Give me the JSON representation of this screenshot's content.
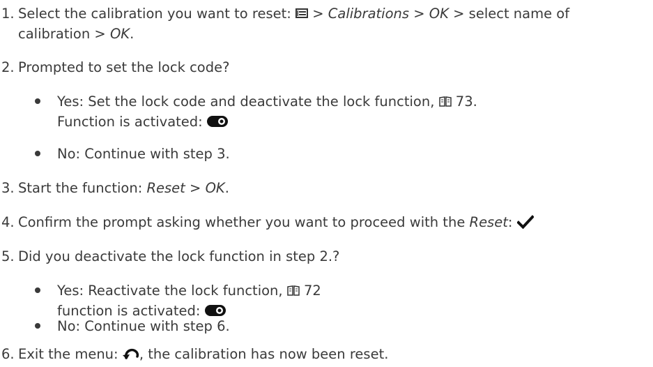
{
  "steps": [
    {
      "number": "1.",
      "text_a": "Select the calibration you want to reset: ",
      "menu_icon": "menu-icon",
      "text_b": " > ",
      "italic_1": "Calibrations",
      "text_c": " > ",
      "italic_2": "OK",
      "text_d": " > select name of",
      "line2_a": "calibration > ",
      "line2_italic": "OK",
      "line2_b": "."
    },
    {
      "number": "2.",
      "text": "Prompted to set the lock code?",
      "bullets": [
        {
          "text_a": "Yes: Set the lock code and deactivate the lock function, ",
          "book_icon": "book-icon",
          "page_ref": " 73.",
          "line2": "Function is activated: ",
          "toggle_icon": "toggle-on-icon"
        },
        {
          "text": "No: Continue with step 3."
        }
      ]
    },
    {
      "number": "3.",
      "text_a": "Start the function: ",
      "italic_1": "Reset",
      "text_b": " > ",
      "italic_2": "OK",
      "text_c": "."
    },
    {
      "number": "4.",
      "text_a": "Confirm the prompt asking whether you want to proceed with the ",
      "italic_1": "Reset",
      "text_b": ": ",
      "check_icon": "checkmark-icon"
    },
    {
      "number": "5.",
      "text": "Did you deactivate the lock function in step 2.?",
      "bullets": [
        {
          "text_a": "Yes: Reactivate the lock function, ",
          "book_icon": "book-icon",
          "page_ref": " 72",
          "line2": "function is activated: ",
          "toggle_icon": "toggle-on-icon"
        },
        {
          "text": "No: Continue with step 6."
        }
      ]
    },
    {
      "number": "6.",
      "text_a": "Exit the menu: ",
      "back_icon": "back-arrow-icon",
      "text_b": ", the calibration has now been reset."
    }
  ]
}
